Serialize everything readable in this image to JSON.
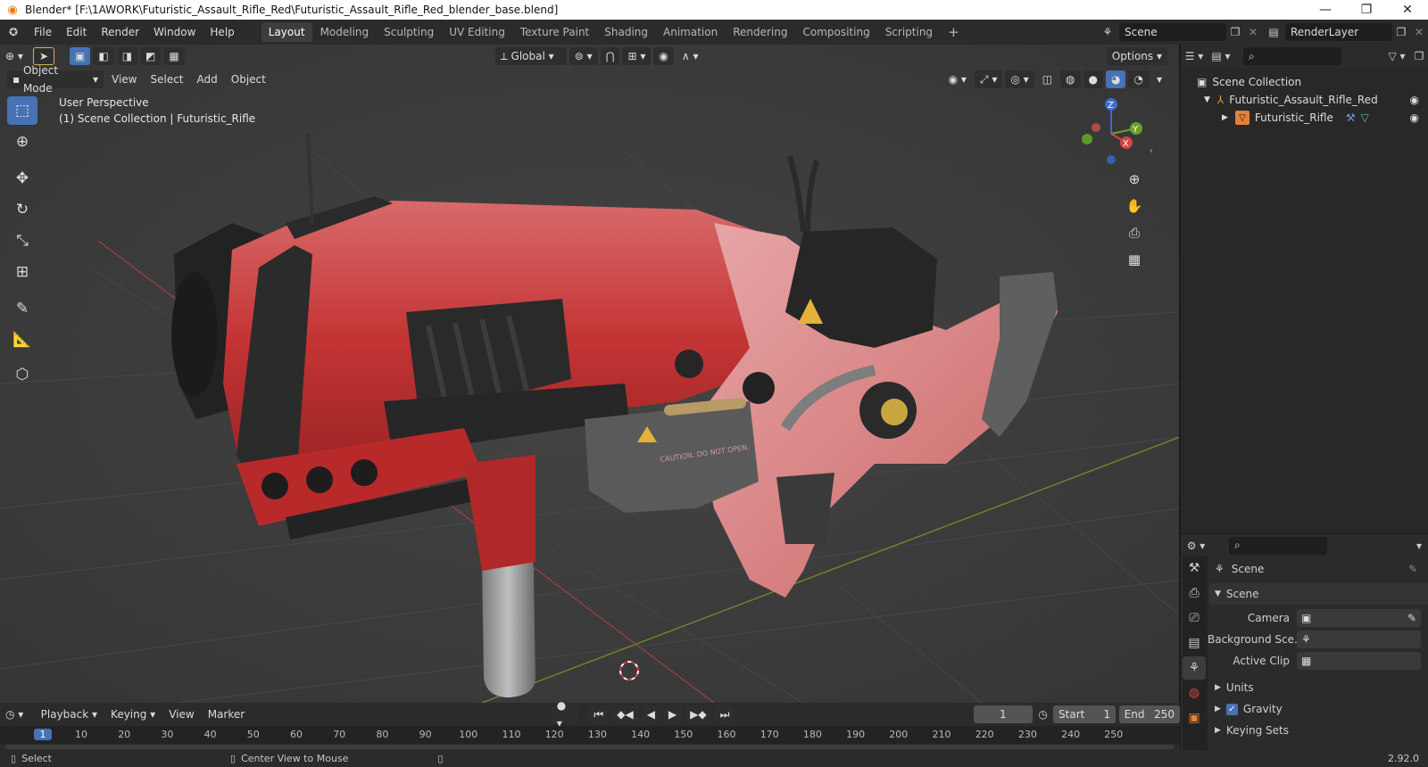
{
  "titlebar": {
    "title": "Blender* [F:\\1AWORK\\Futuristic_Assault_Rifle_Red\\Futuristic_Assault_Rifle_Red_blender_base.blend]",
    "minimize": "—",
    "maximize": "❐",
    "close": "✕"
  },
  "menu": {
    "items": [
      "File",
      "Edit",
      "Render",
      "Window",
      "Help"
    ]
  },
  "workspaces": {
    "tabs": [
      "Layout",
      "Modeling",
      "Sculpting",
      "UV Editing",
      "Texture Paint",
      "Shading",
      "Animation",
      "Rendering",
      "Compositing",
      "Scripting"
    ],
    "add": "+"
  },
  "scene_selector": {
    "value": "Scene"
  },
  "renderlayer_selector": {
    "value": "RenderLayer"
  },
  "viewport": {
    "transform_orientation": "Global",
    "options": "Options",
    "mode": "Object Mode",
    "menus": [
      "View",
      "Select",
      "Add",
      "Object"
    ],
    "overlay_line1": "User Perspective",
    "overlay_line2": "(1) Scene Collection | Futuristic_Rifle",
    "warning1": "CAUTION. DO NOT OPEN.",
    "axis": {
      "z": "Z",
      "y": "Y",
      "x": "X"
    }
  },
  "outliner": {
    "root": "Scene Collection",
    "items": [
      {
        "label": "Futuristic_Assault_Rifle_Red"
      },
      {
        "label": "Futuristic_Rifle"
      }
    ]
  },
  "properties": {
    "context": "Scene",
    "panel": "Scene",
    "rows": [
      {
        "label": "Camera",
        "value": ""
      },
      {
        "label": "Background Sce...",
        "value": ""
      },
      {
        "label": "Active Clip",
        "value": ""
      }
    ],
    "subpanels": [
      "Units",
      "Gravity",
      "Keying Sets"
    ]
  },
  "timeline": {
    "menus": [
      "Playback",
      "Keying",
      "View",
      "Marker"
    ],
    "current_frame": "1",
    "start_label": "Start",
    "start_value": "1",
    "end_label": "End",
    "end_value": "250",
    "ruler": [
      "1",
      "10",
      "20",
      "30",
      "40",
      "50",
      "60",
      "70",
      "80",
      "90",
      "100",
      "110",
      "120",
      "130",
      "140",
      "150",
      "160",
      "170",
      "180",
      "190",
      "200",
      "210",
      "220",
      "230",
      "240",
      "250"
    ]
  },
  "statusbar": {
    "select": "Select",
    "center": "Center View to Mouse",
    "version": "2.92.0"
  }
}
